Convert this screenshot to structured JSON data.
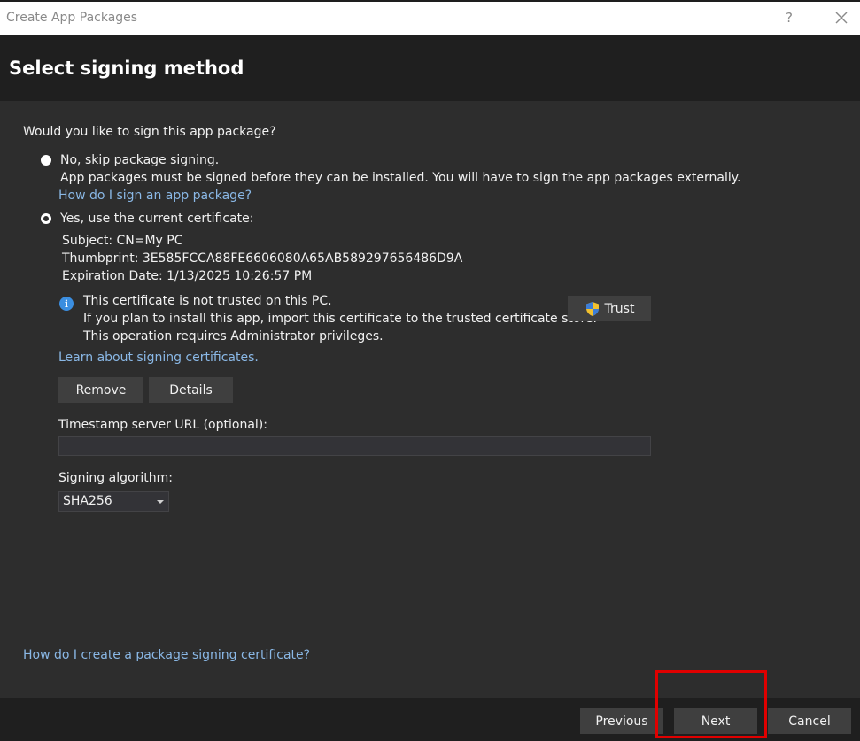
{
  "window": {
    "title": "Create App Packages",
    "help": "?"
  },
  "header": {
    "title": "Select signing method"
  },
  "question": "Would you like to sign this app package?",
  "option_skip": {
    "label": "No, skip package signing.",
    "description": "App packages must be signed before they can be installed. You will have to sign the app packages externally.",
    "link": "How do I sign an app package?"
  },
  "option_current": {
    "label": "Yes, use the current certificate:",
    "subject": "Subject: CN=My PC",
    "thumbprint": "Thumbprint: 3E585FCCA88FE6606080A65AB589297656486D9A",
    "expiration": "Expiration Date: 1/13/2025 10:26:57 PM"
  },
  "trust_notice": {
    "icon": "info-icon",
    "line1": "This certificate is not trusted on this PC.",
    "line2": "If you plan to install this app, import this certificate to the trusted certificate store.",
    "line3": "This operation requires Administrator privileges.",
    "trust_button": "Trust"
  },
  "learn_link": "Learn about signing certificates.",
  "cert_buttons": {
    "remove": "Remove",
    "details": "Details"
  },
  "timestamp": {
    "label": "Timestamp server URL (optional):",
    "value": ""
  },
  "algorithm": {
    "label": "Signing algorithm:",
    "selected": "SHA256"
  },
  "create_cert_link": "How do I create a package signing certificate?",
  "footer": {
    "previous": "Previous",
    "next": "Next",
    "cancel": "Cancel"
  },
  "colors": {
    "accent_link": "#8ab8e6",
    "highlight": "#e00000",
    "info": "#3b8ee0"
  }
}
